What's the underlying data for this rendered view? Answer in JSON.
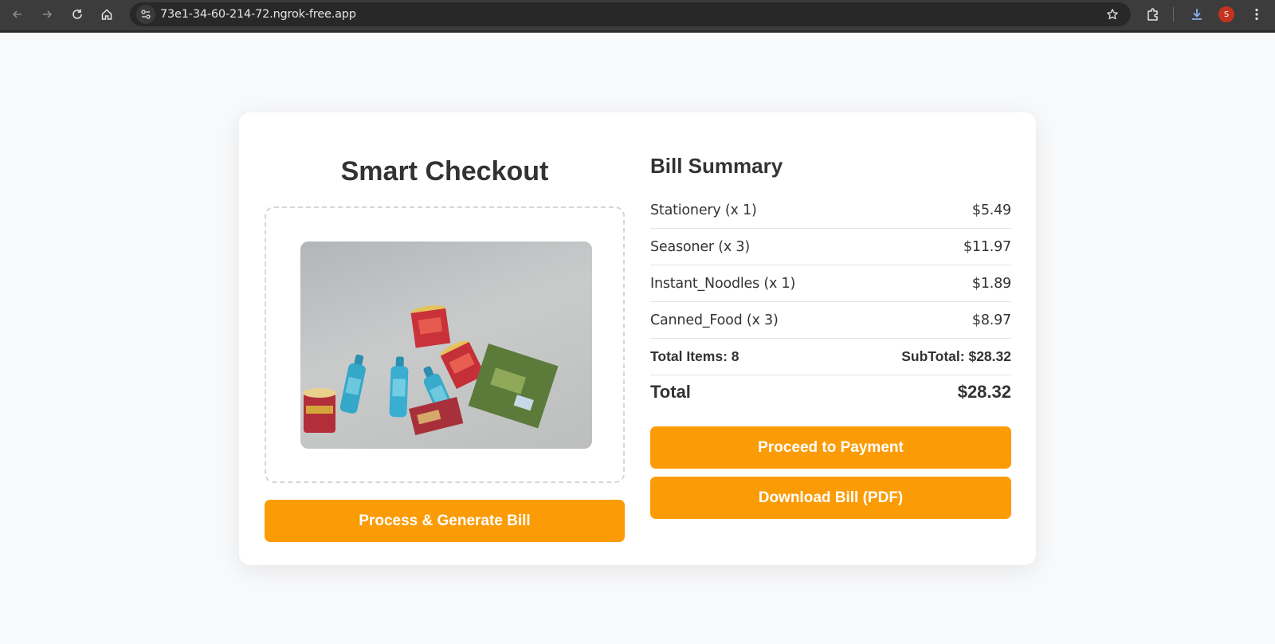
{
  "browser": {
    "url": "73e1-34-60-214-72.ngrok-free.app",
    "profile_initial": "S",
    "profile_color": "#c5331f"
  },
  "checkout": {
    "title": "Smart Checkout",
    "generate_button": "Process & Generate Bill"
  },
  "summary": {
    "title": "Bill Summary",
    "items": [
      {
        "name": "Stationery (x 1)",
        "price": "$5.49"
      },
      {
        "name": "Seasoner (x 3)",
        "price": "$11.97"
      },
      {
        "name": "Instant_Noodles (x 1)",
        "price": "$1.89"
      },
      {
        "name": "Canned_Food (x 3)",
        "price": "$8.97"
      }
    ],
    "total_items": "Total Items: 8",
    "subtotal": "SubTotal: $28.32",
    "total_label": "Total",
    "total_value": "$28.32",
    "pay_button": "Proceed to Payment",
    "pdf_button": "Download Bill (PDF)"
  },
  "colors": {
    "accent": "#fb9b05",
    "text": "#333333",
    "background": "#f8f9fa"
  }
}
